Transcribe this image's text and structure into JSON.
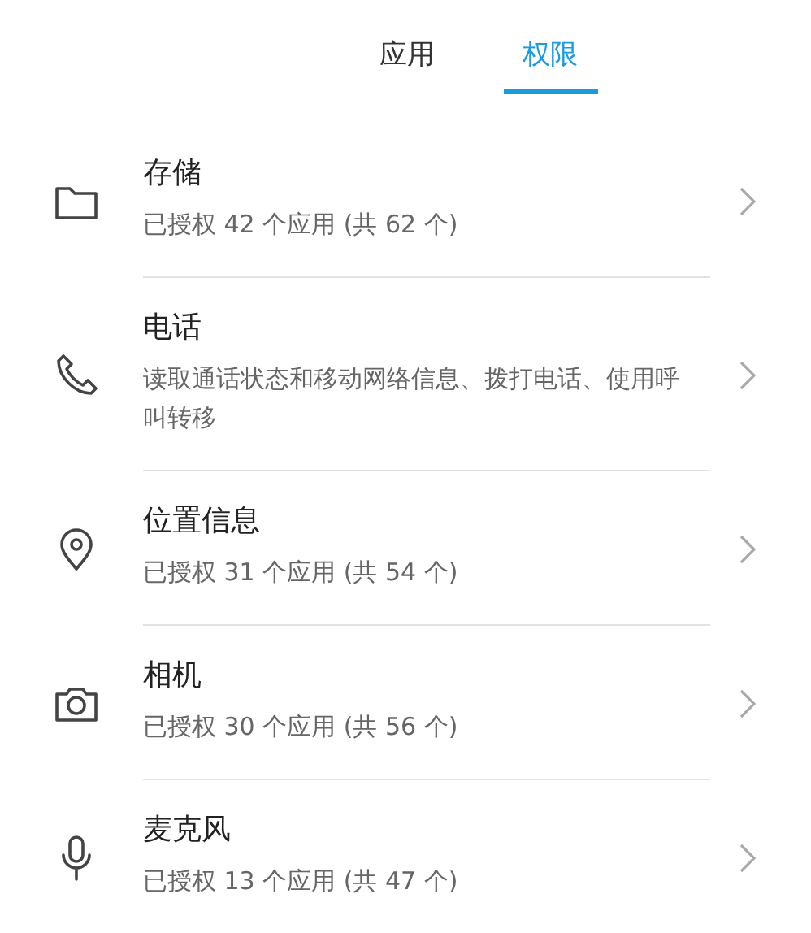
{
  "tabs": [
    {
      "label": "应用",
      "selected": false
    },
    {
      "label": "权限",
      "selected": true
    }
  ],
  "permissions": [
    {
      "kind": "folder",
      "title": "存储",
      "subtitle": "已授权 42 个应用 (共 62 个)"
    },
    {
      "kind": "phone",
      "title": "电话",
      "subtitle": "读取通话状态和移动网络信息、拨打电话、使用呼叫转移"
    },
    {
      "kind": "location",
      "title": "位置信息",
      "subtitle": "已授权 31 个应用 (共 54 个)"
    },
    {
      "kind": "camera",
      "title": "相机",
      "subtitle": "已授权 30 个应用 (共 56 个)"
    },
    {
      "kind": "microphone",
      "title": "麦克风",
      "subtitle": "已授权 13 个应用 (共 47 个)"
    }
  ]
}
